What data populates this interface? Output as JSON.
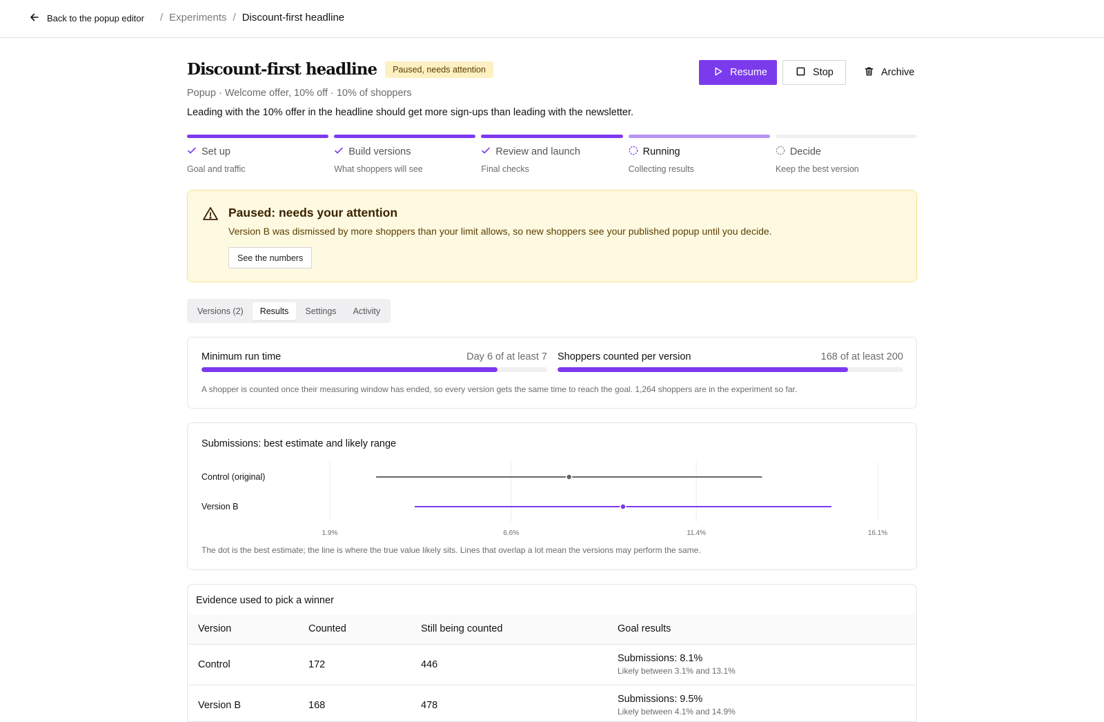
{
  "topbar": {
    "back_label": "Back to the popup editor",
    "breadcrumbs": [
      "Experiments",
      "Discount-first headline"
    ]
  },
  "experiment": {
    "title": "Discount-first headline",
    "status_badge": "Paused, needs attention",
    "subtitle": "Popup · Welcome offer, 10% off · 10% of shoppers",
    "hypothesis": "Leading with the 10% offer in the headline should get more sign-ups than leading with the newsletter."
  },
  "actions": {
    "resume": "Resume",
    "stop": "Stop",
    "archive": "Archive"
  },
  "steps": [
    {
      "label": "Set up",
      "desc": "Goal and traffic",
      "state": "done"
    },
    {
      "label": "Build versions",
      "desc": "What shoppers will see",
      "state": "done"
    },
    {
      "label": "Review and launch",
      "desc": "Final checks",
      "state": "done"
    },
    {
      "label": "Running",
      "desc": "Collecting results",
      "state": "current"
    },
    {
      "label": "Decide",
      "desc": "Keep the best version",
      "state": "todo"
    }
  ],
  "alert": {
    "title": "Paused: needs your attention",
    "text": "Version B was dismissed by more shoppers than your limit allows, so new shoppers see your published popup until you decide.",
    "button": "See the numbers"
  },
  "tabs": [
    {
      "label": "Versions (2)",
      "active": false
    },
    {
      "label": "Results",
      "active": true
    },
    {
      "label": "Settings",
      "active": false
    },
    {
      "label": "Activity",
      "active": false
    }
  ],
  "gates": {
    "min_run": {
      "label": "Minimum run time",
      "value": "Day 6 of at least 7",
      "progress": 0.857
    },
    "counted": {
      "label": "Shoppers counted per version",
      "value": "168 of at least 200",
      "progress": 0.84
    },
    "note": "A shopper is counted once their measuring window has ended, so every version gets the same time to reach the goal. 1,264 shoppers are in the experiment so far."
  },
  "chart_card": {
    "title": "Submissions: best estimate and likely range",
    "note": "The dot is the best estimate; the line is where the true value likely sits. Lines that overlap a lot mean the versions may perform the same."
  },
  "chart_data": {
    "type": "scatter",
    "title": "Submissions: best estimate and likely range",
    "xlim": [
      1.9,
      16.1
    ],
    "x_ticks": [
      1.9,
      6.6,
      11.4,
      16.1
    ],
    "x_tick_labels": [
      "1.9%",
      "6.6%",
      "11.4%",
      "16.1%"
    ],
    "series": [
      {
        "name": "Control (original)",
        "estimate": 8.1,
        "low": 3.1,
        "high": 13.1,
        "color": "#666666"
      },
      {
        "name": "Version B",
        "estimate": 9.5,
        "low": 4.1,
        "high": 14.9,
        "color": "#7c3aed"
      }
    ]
  },
  "evidence": {
    "title": "Evidence used to pick a winner",
    "columns": [
      "Version",
      "Counted",
      "Still being counted",
      "Goal results"
    ],
    "rows": [
      {
        "version": "Control",
        "counted": "172",
        "pending": "446",
        "goal": "Submissions: 8.1%",
        "goal_range": "Likely between 3.1% and 13.1%"
      },
      {
        "version": "Version B",
        "counted": "168",
        "pending": "478",
        "goal": "Submissions: 9.5%",
        "goal_range": "Likely between 4.1% and 14.9%"
      }
    ]
  },
  "colors": {
    "accent": "#7c3aed",
    "accent_light": "#b794f4",
    "badge_bg": "#fdf0c2",
    "alert_bg": "#fefae1",
    "alert_border": "#f6e08a"
  }
}
